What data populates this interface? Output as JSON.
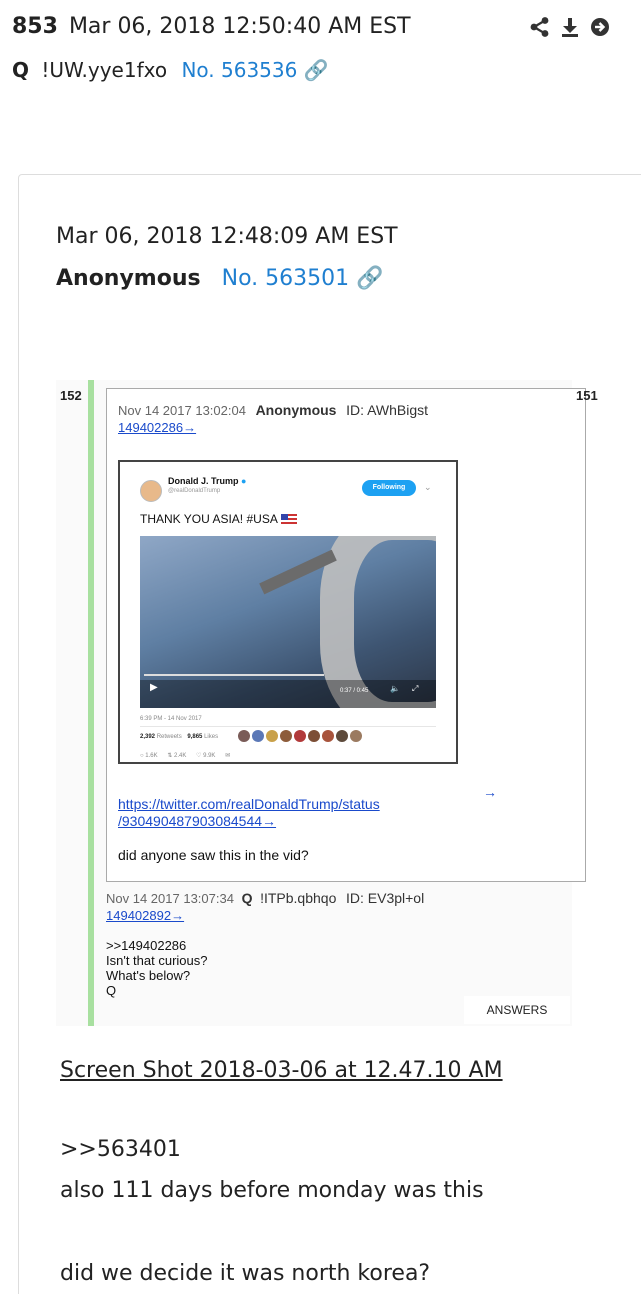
{
  "post": {
    "number": "853",
    "date": "Mar 06, 2018 12:50:40 AM EST",
    "author": "Q",
    "tripcode": "!UW.yye1fxo",
    "post_no": "No. 563536"
  },
  "actions": {
    "share_icon": "share-icon",
    "download_icon": "download-icon",
    "forward_icon": "arrow-right-circle-icon"
  },
  "quoted": {
    "date": "Mar 06, 2018 12:48:09 AM EST",
    "author": "Anonymous",
    "post_no": "No. 563501",
    "screenshot_link": "Screen Shot 2018-03-06 at 12.47.10 AM",
    "body": [
      ">>563401",
      "also 111 days before monday was this",
      "did we decide it was north korea?"
    ]
  },
  "screenshot": {
    "left_num": "152",
    "right_num": "151",
    "post1": {
      "date": "Nov 14 2017 13:02:04",
      "author": "Anonymous",
      "id": "ID: AWhBigst",
      "num": "149402286→",
      "link_line1": "https://twitter.com/realDonaldTrump/status",
      "link_line2": "/930490487903084544→",
      "text": "did anyone saw this in the vid?",
      "arrow": "→"
    },
    "tweet": {
      "name": "Donald J. Trump",
      "handle": "@realDonaldTrump",
      "follow": "Following",
      "text": "THANK YOU ASIA! #USA",
      "time": "0:37 / 0:45",
      "date": "6:39 PM - 14 Nov 2017",
      "retweets_num": "2,392",
      "retweets_label": "Retweets",
      "likes_num": "9,865",
      "likes_label": "Likes",
      "reply_count": "1.6K",
      "rt_count": "2.4K",
      "like_count": "9.9K"
    },
    "post2": {
      "date": "Nov 14 2017 13:07:34",
      "author": "Q",
      "trip": "!ITPb.qbhqo",
      "id": "ID: EV3pl+ol",
      "num": "149402892→",
      "lines": [
        ">>149402286",
        "Isn't that curious?",
        "What's below?",
        "Q"
      ],
      "answers": "ANSWERS"
    }
  }
}
